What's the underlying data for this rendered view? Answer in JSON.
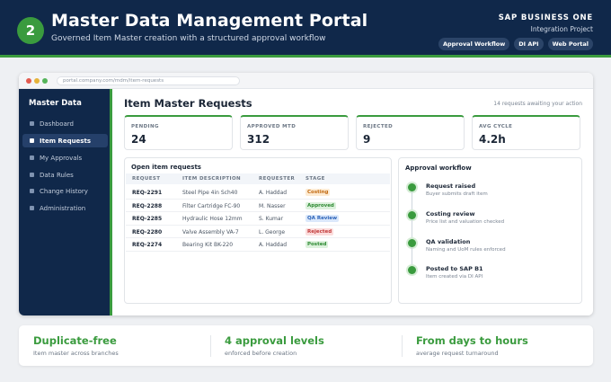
{
  "banner": {
    "step": "2",
    "title": "Master Data Management Portal",
    "subtitle": "Governed Item Master creation with a structured approval workflow",
    "brand": "SAP BUSINESS ONE",
    "brand_sub": "Integration Project",
    "tags": [
      "Approval Workflow",
      "DI API",
      "Web Portal"
    ]
  },
  "window": {
    "url": "portal.company.com/mdm/item-requests"
  },
  "sidebar": {
    "title": "Master Data",
    "items": [
      {
        "label": "Dashboard",
        "active": false
      },
      {
        "label": "Item Requests",
        "active": true
      },
      {
        "label": "My Approvals",
        "active": false
      },
      {
        "label": "Data Rules",
        "active": false
      },
      {
        "label": "Change History",
        "active": false
      },
      {
        "label": "Administration",
        "active": false
      }
    ]
  },
  "main": {
    "title": "Item Master Requests",
    "await_note": "14 requests awaiting your action",
    "kpis": [
      {
        "label": "PENDING",
        "value": "24"
      },
      {
        "label": "APPROVED MTD",
        "value": "312"
      },
      {
        "label": "REJECTED",
        "value": "9"
      },
      {
        "label": "AVG CYCLE",
        "value": "4.2h"
      }
    ],
    "requests": {
      "title": "Open item requests",
      "columns": [
        "REQUEST",
        "ITEM DESCRIPTION",
        "REQUESTER",
        "STAGE"
      ],
      "rows": [
        {
          "id": "REQ-2291",
          "desc": "Steel Pipe 4in Sch40",
          "requester": "A. Haddad",
          "stage": "Costing"
        },
        {
          "id": "REQ-2288",
          "desc": "Filter Cartridge FC-90",
          "requester": "M. Nasser",
          "stage": "Approved"
        },
        {
          "id": "REQ-2285",
          "desc": "Hydraulic Hose 12mm",
          "requester": "S. Kumar",
          "stage": "QA Review"
        },
        {
          "id": "REQ-2280",
          "desc": "Valve Assembly VA-7",
          "requester": "L. George",
          "stage": "Rejected"
        },
        {
          "id": "REQ-2274",
          "desc": "Bearing Kit BK-220",
          "requester": "A. Haddad",
          "stage": "Posted"
        }
      ]
    },
    "workflow": {
      "title": "Approval workflow",
      "steps": [
        {
          "title": "Request raised",
          "desc": "Buyer submits draft item"
        },
        {
          "title": "Costing review",
          "desc": "Price list and valuation checked"
        },
        {
          "title": "QA validation",
          "desc": "Naming and UoM rules enforced"
        },
        {
          "title": "Posted to SAP B1",
          "desc": "Item created via DI API"
        }
      ]
    }
  },
  "stage_colors": {
    "Costing": {
      "bg": "#fdebd3",
      "fg": "#c26a12"
    },
    "Approved": {
      "bg": "#dcf1dc",
      "fg": "#2e8a33"
    },
    "QA Review": {
      "bg": "#dbe8fb",
      "fg": "#2c63b8"
    },
    "Rejected": {
      "bg": "#fbdcdc",
      "fg": "#c23a3a"
    },
    "Posted": {
      "bg": "#dcf1dc",
      "fg": "#2e8a33"
    }
  },
  "stats": [
    {
      "title": "Duplicate-free",
      "sub": "Item master across branches"
    },
    {
      "title": "4 approval levels",
      "sub": "enforced before creation"
    },
    {
      "title": "From days to hours",
      "sub": "average request turnaround"
    }
  ]
}
